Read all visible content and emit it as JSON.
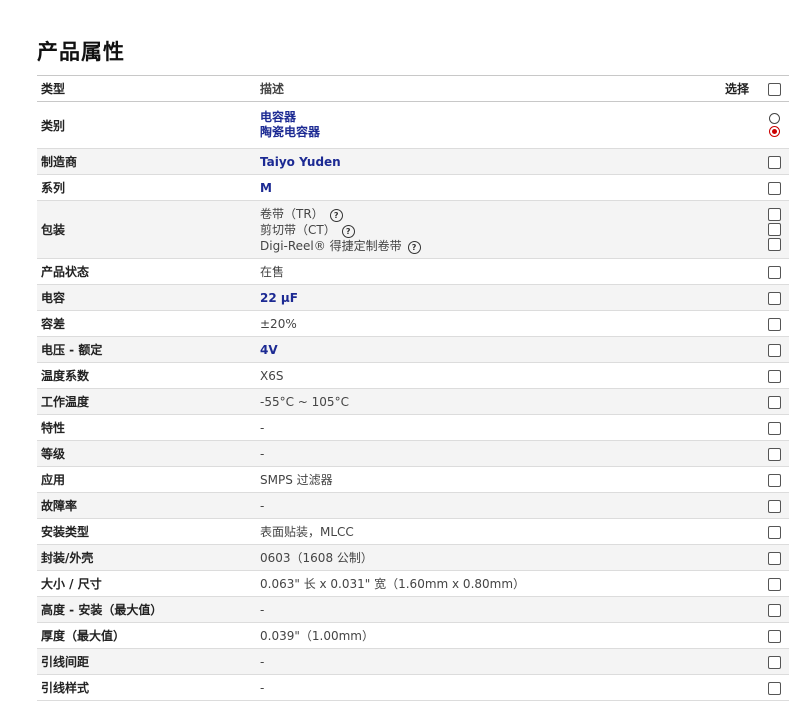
{
  "title": "产品属性",
  "headers": {
    "type": "类型",
    "desc": "描述",
    "select": "选择"
  },
  "rows": {
    "category": {
      "label": "类别",
      "values": [
        "电容器",
        "陶瓷电容器"
      ]
    },
    "manufacturer": {
      "label": "制造商",
      "value": "Taiyo Yuden"
    },
    "series": {
      "label": "系列",
      "value": "M"
    },
    "packaging": {
      "label": "包装",
      "values": [
        "卷带（TR）",
        "剪切带（CT）",
        "Digi-Reel® 得捷定制卷带"
      ]
    },
    "status": {
      "label": "产品状态",
      "value": "在售"
    },
    "capacitance": {
      "label": "电容",
      "value": "22 µF"
    },
    "tolerance": {
      "label": "容差",
      "value": "±20%"
    },
    "voltage": {
      "label": "电压 - 额定",
      "value": "4V"
    },
    "tempcoef": {
      "label": "温度系数",
      "value": "X6S"
    },
    "optemp": {
      "label": "工作温度",
      "value": "-55°C ~ 105°C"
    },
    "features": {
      "label": "特性",
      "value": "-"
    },
    "ratings": {
      "label": "等级",
      "value": "-"
    },
    "applications": {
      "label": "应用",
      "value": "SMPS 过滤器"
    },
    "failure": {
      "label": "故障率",
      "value": "-"
    },
    "mounting": {
      "label": "安装类型",
      "value": "表面贴装，MLCC"
    },
    "package": {
      "label": "封装/外壳",
      "value": "0603（1608 公制）"
    },
    "size": {
      "label": "大小 / 尺寸",
      "value": "0.063\" 长 x 0.031\" 宽（1.60mm x 0.80mm）"
    },
    "height": {
      "label": "高度 - 安装（最大值）",
      "value": "-"
    },
    "thickness": {
      "label": "厚度（最大值）",
      "value": "0.039\"（1.00mm）"
    },
    "leadspacing": {
      "label": "引线间距",
      "value": "-"
    },
    "leadstyle": {
      "label": "引线样式",
      "value": "-"
    }
  },
  "icons": {
    "help": "question-circle-icon"
  },
  "colors": {
    "link": "#1c2a93",
    "radio_selected": "#cc0000"
  },
  "help_glyph": "?"
}
